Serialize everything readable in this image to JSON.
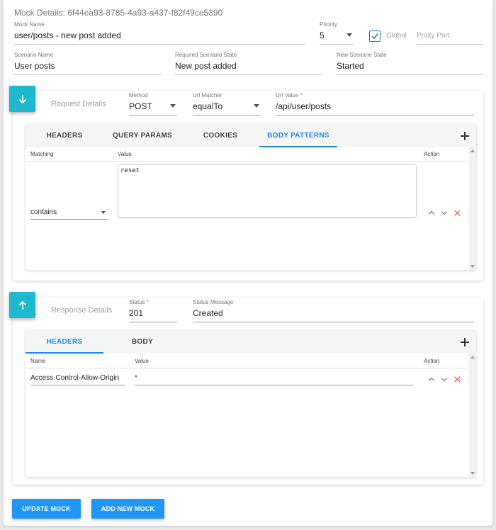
{
  "mock": {
    "title_prefix": "Mock Details: ",
    "mock_id": "6f44ea93-8785-4a93-a437-f82f49ce5390",
    "name_label": "Mock Name",
    "name_value": "user/posts - new post added",
    "priority_label": "Priority",
    "priority_value": "5",
    "global_label": "Global",
    "global_checked": true,
    "proxy_port_placeholder": "Proxy Port",
    "scenario_name_label": "Scenario Name",
    "scenario_name_value": "User posts",
    "required_state_label": "Required Scenario State",
    "required_state_value": "New post added",
    "new_state_label": "New Scenario State",
    "new_state_value": "Started"
  },
  "request": {
    "section_title": "Request Details",
    "method_label": "Method",
    "method_value": "POST",
    "url_matcher_label": "Url Matcher",
    "url_matcher_value": "equalTo",
    "url_value_label": "Url Value *",
    "url_value": "/api/user/posts",
    "tabs": [
      "HEADERS",
      "QUERY PARAMS",
      "COOKIES",
      "BODY PATTERNS"
    ],
    "active_tab": "BODY PATTERNS",
    "columns": {
      "matching": "Matching",
      "value": "Value",
      "action": "Action"
    },
    "rows": [
      {
        "matching": "contains",
        "value": "reset"
      }
    ]
  },
  "response": {
    "section_title": "Response Details",
    "status_label": "Status *",
    "status_value": "201",
    "status_message_label": "Status Message",
    "status_message_value": "Created",
    "tabs": [
      "HEADERS",
      "BODY"
    ],
    "active_tab": "HEADERS",
    "columns": {
      "name": "Name",
      "value": "Value",
      "action": "Action"
    },
    "rows": [
      {
        "name": "Access-Control-Allow-Origin",
        "value": "*"
      }
    ]
  },
  "buttons": {
    "update": "UPDATE MOCK",
    "add_new": "ADD NEW MOCK"
  },
  "colors": {
    "accent": "#1e88e5",
    "fab": "#1fb8ce",
    "button": "#2196f3",
    "delete": "#e53935"
  }
}
